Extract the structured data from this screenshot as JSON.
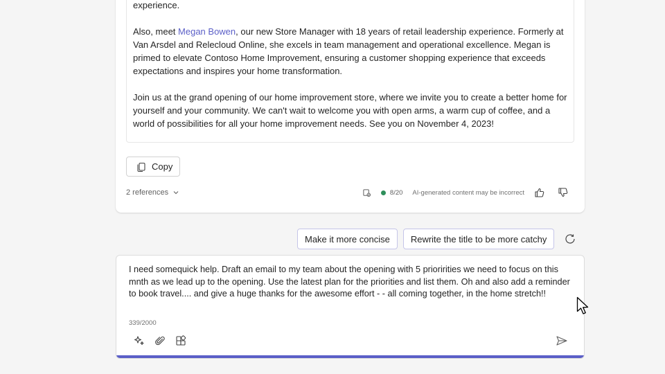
{
  "response": {
    "paragraph_1": "journey. Relax in our welcoming coffee shop and let us assist you in creating a captivating shopping experience.",
    "p2_before": "Also, meet ",
    "p2_mention": "Megan Bowen",
    "p2_after": ", our new Store Manager with 18 years of retail leadership experience. Formerly at Van Arsdel and Relecloud Online, she excels in team management and operational excellence. Megan is primed to elevate Contoso Home Improvement, ensuring a customer shopping experience that exceeds expectations and inspires your home transformation.",
    "paragraph_3": "Join us at the grand opening of our home improvement store, where we invite you to create a better home for yourself and your community. We can't wait to welcome you with open arms, a warm cup of coffee, and a world of possibilities for all your home improvement needs. See you on November 4, 2023!",
    "copy_label": "Copy",
    "references_label": "2 references",
    "counter": "8/20",
    "ai_note": "AI-generated content may be incorrect"
  },
  "suggestions": [
    "Make it more concise",
    "Rewrite the title to be more catchy"
  ],
  "composer": {
    "text": "I need somequick help. Draft an email to my team about the opening with 5 prioririties we need to focus on this mnth as we lead up to the opening. Use the latest plan for the priorities and list them. Oh and also add a reminder to book travel.... and give a huge thanks for the awesome effort - - all coming together, in the home stretch!!",
    "char_count": "339/2000"
  },
  "colors": {
    "accent": "#5b5fc7",
    "status_green": "#2f8f5b"
  },
  "icons": [
    "copy-icon",
    "chevron-down-icon",
    "sensitivity-icon",
    "thumbs-up-icon",
    "thumbs-down-icon",
    "refresh-icon",
    "sparkle-icon",
    "attach-icon",
    "apps-icon",
    "send-icon",
    "mouse-cursor-icon"
  ]
}
